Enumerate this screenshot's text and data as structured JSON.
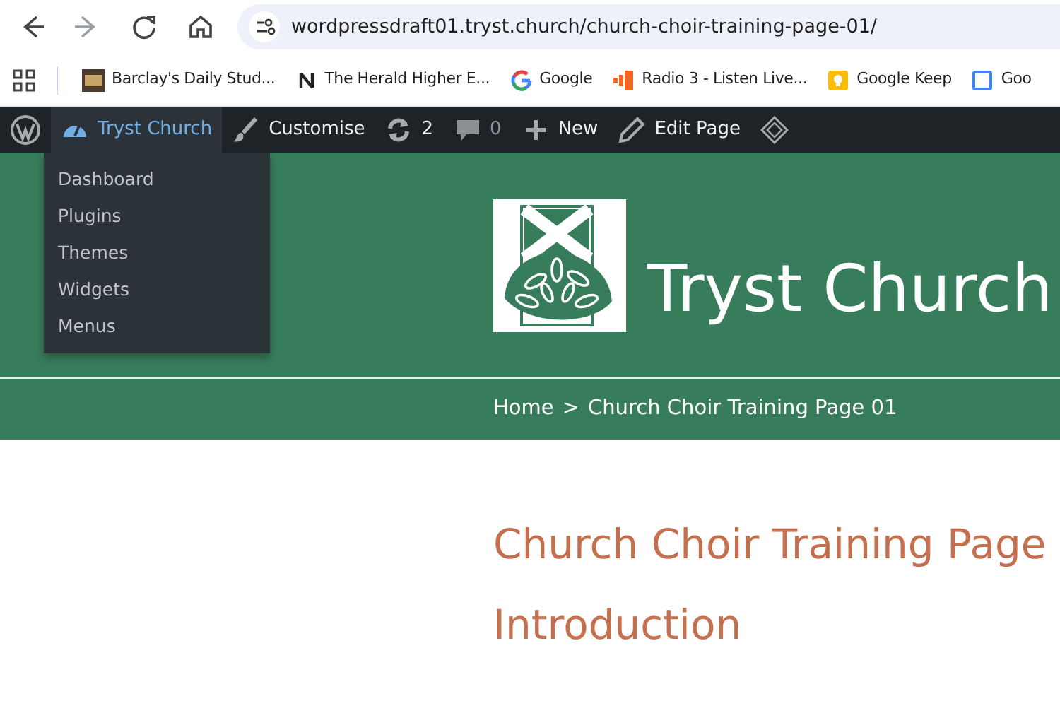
{
  "browser": {
    "nav_buttons": [
      {
        "kind": "back",
        "disabled": false
      },
      {
        "kind": "forward",
        "disabled": true
      },
      {
        "kind": "reload",
        "disabled": false
      },
      {
        "kind": "home",
        "disabled": false
      }
    ],
    "url": "wordpressdraft01.tryst.church/church-choir-training-page-01/",
    "bookmarks": [
      {
        "kind": "sl",
        "label": "Barclay's Daily Stud..."
      },
      {
        "kind": "n",
        "label": "The Herald Higher E..."
      },
      {
        "kind": "g",
        "label": "Google"
      },
      {
        "kind": "radio",
        "label": "Radio 3 - Listen Live..."
      },
      {
        "kind": "keep",
        "label": "Google Keep"
      },
      {
        "kind": "cal",
        "label": "Goo"
      }
    ]
  },
  "admin_bar": {
    "items": [
      {
        "kind": "site",
        "label": "Tryst Church",
        "selected": true
      },
      {
        "kind": "customise",
        "label": "Customise",
        "selected": false
      },
      {
        "kind": "updates",
        "label": "2",
        "selected": false
      },
      {
        "kind": "comments",
        "label": "0",
        "selected": false
      },
      {
        "kind": "new",
        "label": "New",
        "selected": false
      },
      {
        "kind": "edit",
        "label": "Edit Page",
        "selected": false
      },
      {
        "kind": "plugin",
        "selected": false
      }
    ],
    "dropdown": [
      "Dashboard",
      "Plugins",
      "Themes",
      "Widgets",
      "Menus"
    ]
  },
  "header": {
    "site_title": "Tryst Church",
    "breadcrumb": [
      "Home",
      ">",
      "Church Choir Training Page 01"
    ]
  },
  "content": {
    "title": "Church Choir Training Page",
    "heading": "Introduction"
  }
}
